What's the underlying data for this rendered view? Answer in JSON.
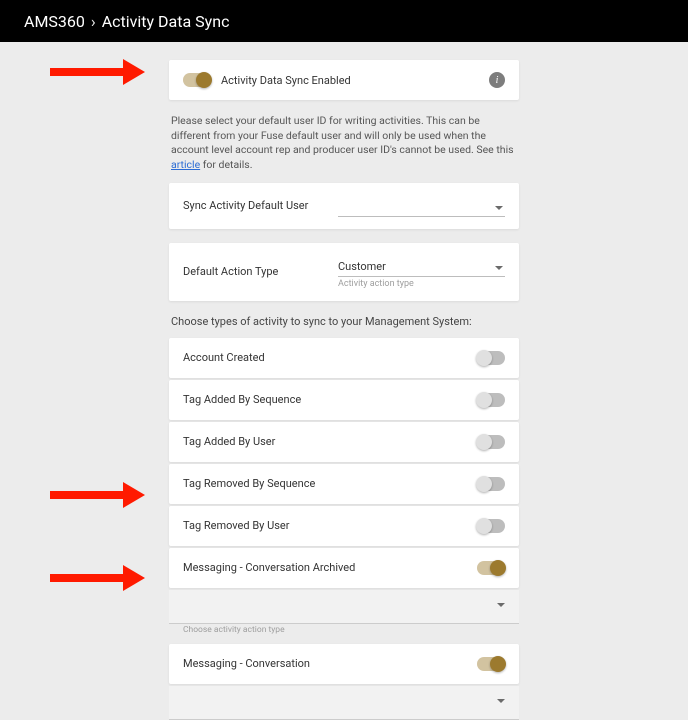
{
  "breadcrumb": {
    "root": "AMS360",
    "sep": "›",
    "page": "Activity Data Sync"
  },
  "main_toggle": {
    "label": "Activity Data Sync Enabled"
  },
  "help": {
    "text_before_link": "Please select your default user ID for writing activities. This can be different from your Fuse default user and will only be used when the account level account rep and producer user ID's cannot be used. See this ",
    "link_text": "article",
    "text_after_link": " for details."
  },
  "default_user": {
    "label": "Sync Activity Default User",
    "value": ""
  },
  "default_action": {
    "label": "Default Action Type",
    "value": "Customer",
    "hint": "Activity action type"
  },
  "section_intro": "Choose types of activity to sync to your Management System:",
  "activities": [
    {
      "label": "Account Created",
      "on": false
    },
    {
      "label": "Tag Added By Sequence",
      "on": false
    },
    {
      "label": "Tag Added By User",
      "on": false
    },
    {
      "label": "Tag Removed By Sequence",
      "on": false
    },
    {
      "label": "Tag Removed By User",
      "on": false
    },
    {
      "label": "Messaging - Conversation Archived",
      "on": true
    },
    {
      "label": "Messaging - Conversation",
      "on": true
    }
  ],
  "sub_select": {
    "value": "",
    "hint": "Choose activity action type"
  }
}
